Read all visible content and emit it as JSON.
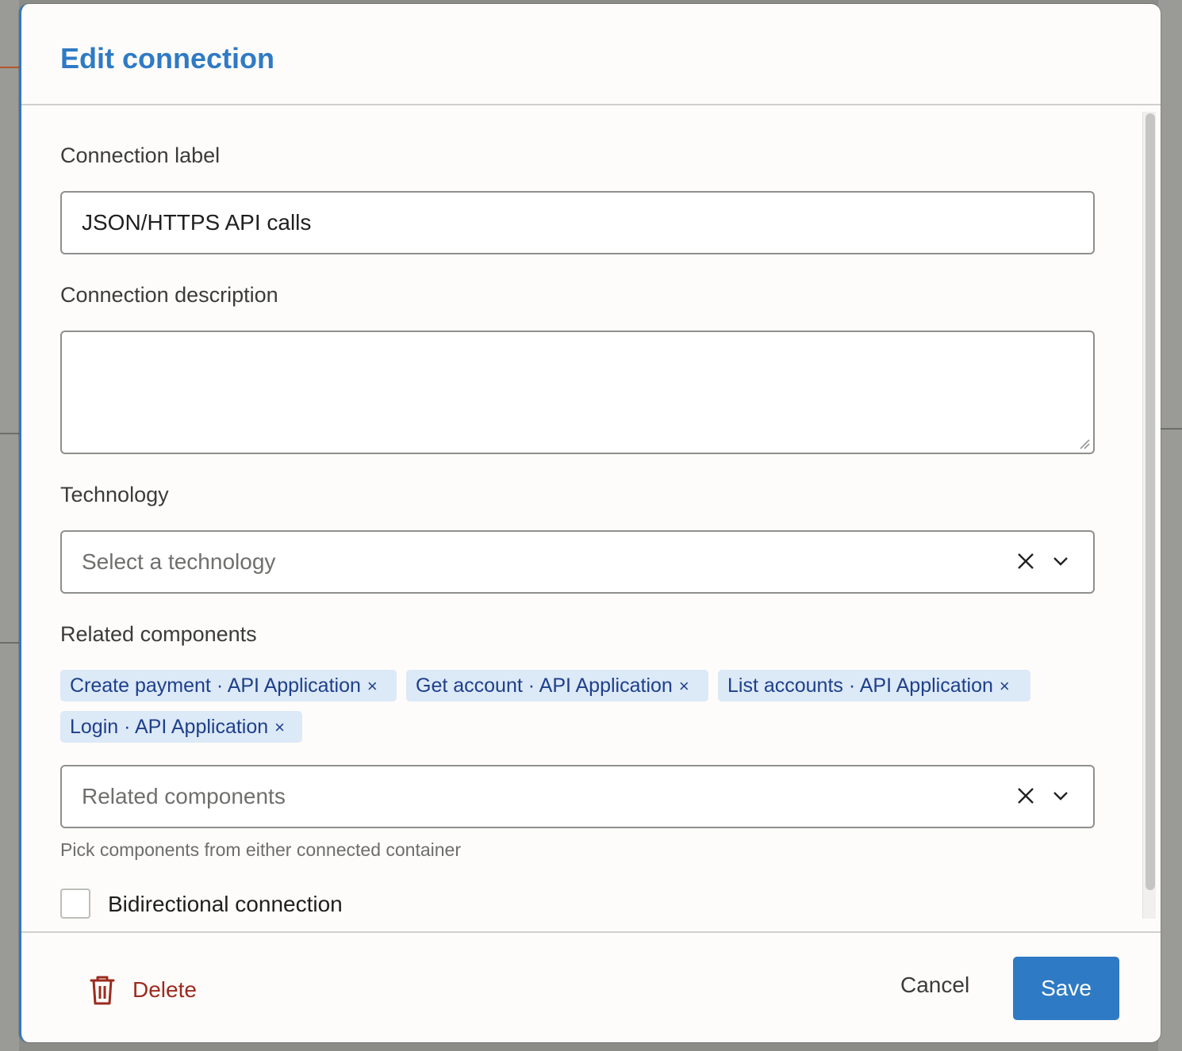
{
  "dialog": {
    "title": "Edit connection"
  },
  "form": {
    "label_field": {
      "label": "Connection label",
      "value": "JSON/HTTPS API calls"
    },
    "description_field": {
      "label": "Connection description",
      "value": ""
    },
    "technology_field": {
      "label": "Technology",
      "placeholder": "Select a technology"
    },
    "related_components": {
      "label": "Related components",
      "chips": [
        {
          "text": "Create payment · API Application",
          "remove": "×"
        },
        {
          "text": "Get account · API Application",
          "remove": "×"
        },
        {
          "text": "List accounts · API Application",
          "remove": "×"
        },
        {
          "text": "Login · API Application",
          "remove": "×"
        }
      ],
      "placeholder": "Related components",
      "hint": "Pick components from either connected container"
    },
    "bidirectional": {
      "label": "Bidirectional connection",
      "checked": false
    }
  },
  "footer": {
    "delete_label": "Delete",
    "cancel_label": "Cancel",
    "save_label": "Save"
  },
  "colors": {
    "accent": "#2f7ac4",
    "danger": "#9c2a1e",
    "chip_bg": "#dce9f7",
    "chip_text": "#1e3f8a"
  }
}
